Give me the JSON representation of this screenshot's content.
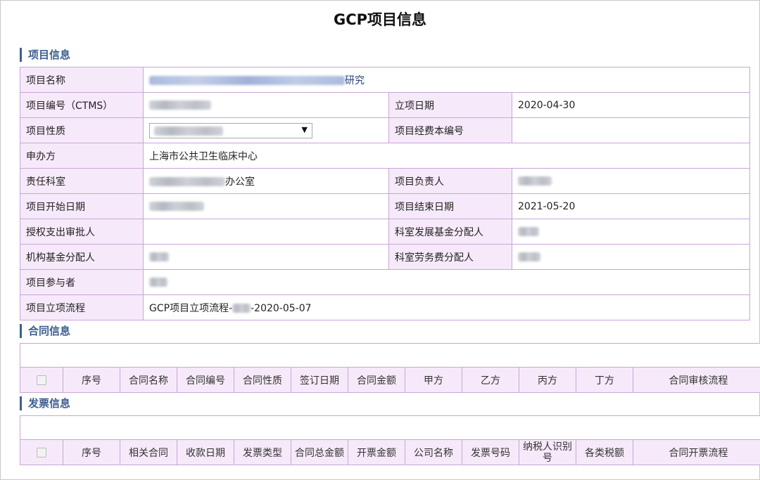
{
  "page": {
    "title": "GCP项目信息"
  },
  "sections": {
    "project": "项目信息",
    "contract": "合同信息",
    "invoice": "发票信息"
  },
  "project_info": {
    "name_label": "项目名称",
    "name_suffix": "研究",
    "code_label": "项目编号（CTMS）",
    "setup_date_label": "立项日期",
    "setup_date": "2020-04-30",
    "nature_label": "项目性质",
    "fund_code_label": "项目经费本编号",
    "sponsor_label": "申办方",
    "sponsor": "上海市公共卫生临床中心",
    "dept_label": "责任科室",
    "dept_suffix": "办公室",
    "leader_label": "项目负责人",
    "start_date_label": "项目开始日期",
    "end_date_label": "项目结束日期",
    "end_date": "2021-05-20",
    "approver_label": "授权支出审批人",
    "dept_fund_label": "科室发展基金分配人",
    "org_fund_label": "机构基金分配人",
    "labor_fee_label": "科室劳务费分配人",
    "participants_label": "项目参与者",
    "process_label": "项目立项流程",
    "process_prefix": "GCP项目立项流程-",
    "process_suffix": "-2020-05-07"
  },
  "contract_table": {
    "columns": [
      "序号",
      "合同名称",
      "合同编号",
      "合同性质",
      "签订日期",
      "合同金额",
      "甲方",
      "乙方",
      "丙方",
      "丁方",
      "合同审核流程"
    ]
  },
  "invoice_table": {
    "columns": [
      "序号",
      "相关合同",
      "收款日期",
      "发票类型",
      "合同总金额",
      "开票金额",
      "公司名称",
      "发票号码",
      "纳税人识别号",
      "各类税额",
      "合同开票流程"
    ]
  }
}
